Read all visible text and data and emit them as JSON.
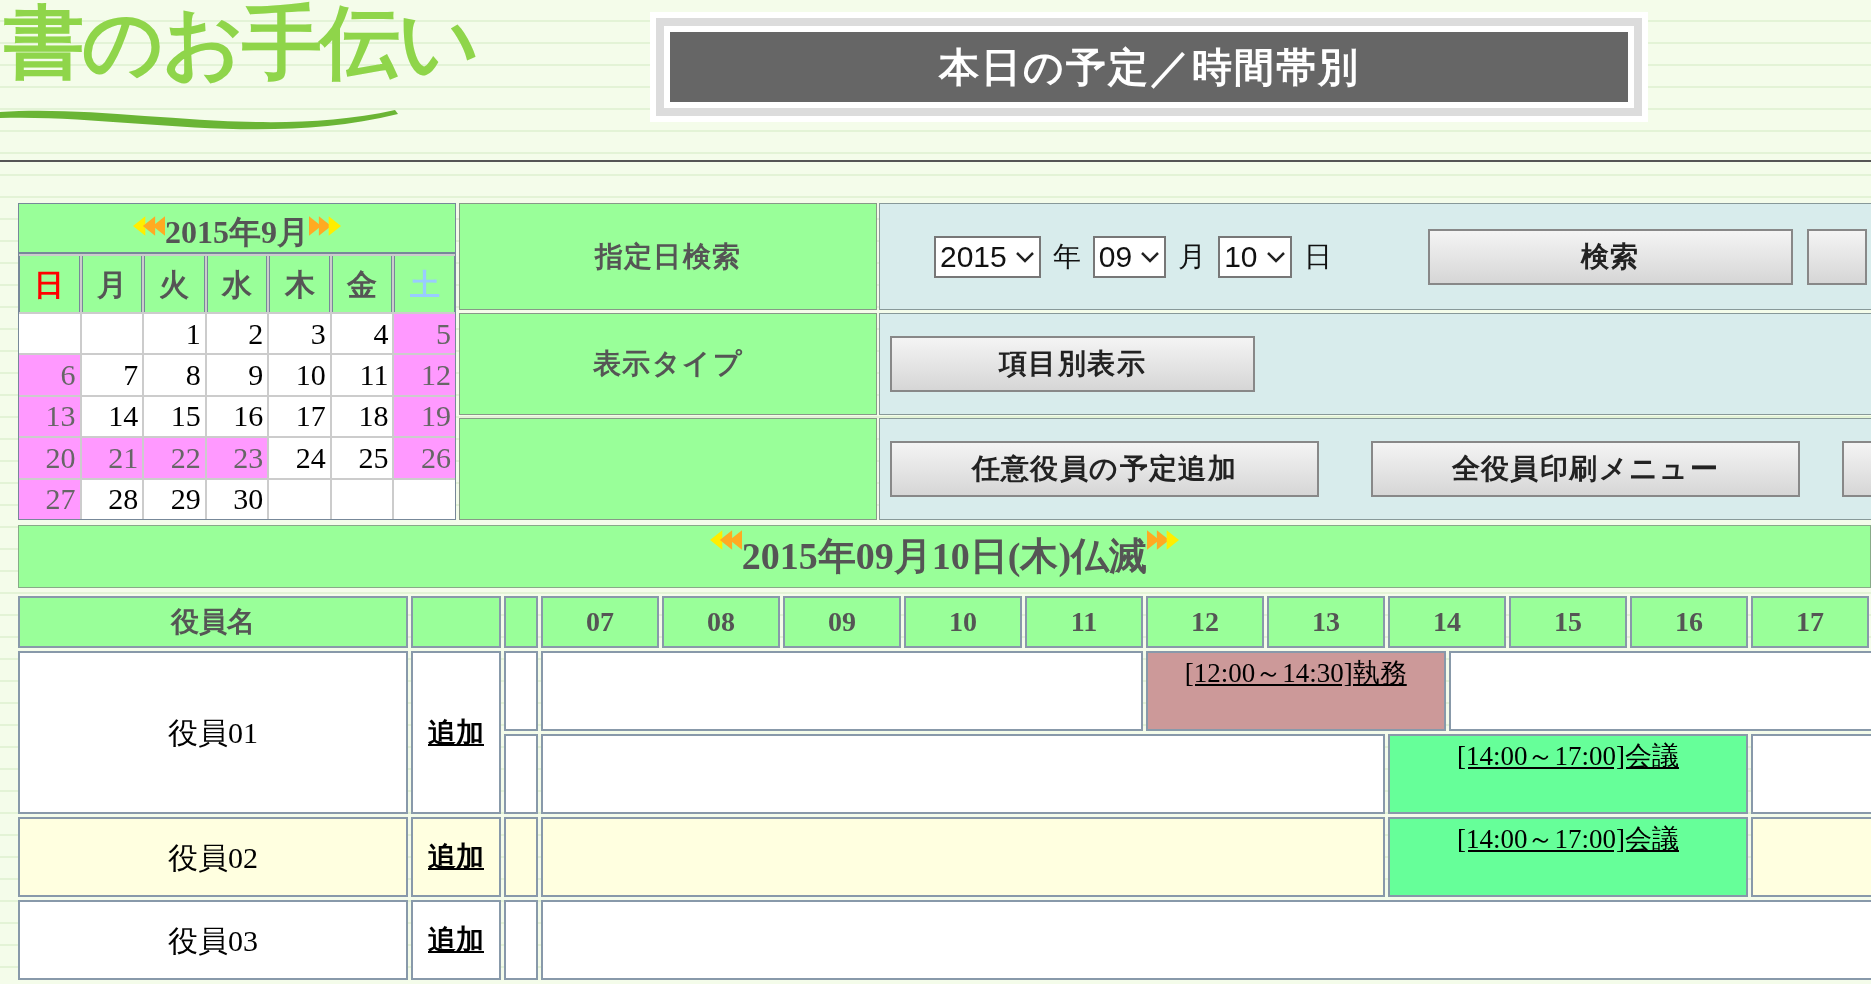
{
  "logo": {
    "text": "書のお手伝い"
  },
  "title": "本日の予定／時間帯別",
  "calendar": {
    "month": "2015年9月",
    "weekdays": [
      {
        "label": "日",
        "kind": "sunday"
      },
      {
        "label": "月",
        "kind": "weekday"
      },
      {
        "label": "火",
        "kind": "weekday"
      },
      {
        "label": "水",
        "kind": "weekday"
      },
      {
        "label": "木",
        "kind": "weekday"
      },
      {
        "label": "金",
        "kind": "weekday"
      },
      {
        "label": "土",
        "kind": "saturday"
      }
    ],
    "weeks": [
      [
        {
          "holiday": false
        },
        {
          "holiday": false
        },
        {
          "day": "1",
          "holiday": false
        },
        {
          "day": "2",
          "holiday": false
        },
        {
          "day": "3",
          "holiday": false
        },
        {
          "day": "4",
          "holiday": false
        },
        {
          "day": "5",
          "holiday": true
        }
      ],
      [
        {
          "day": "6",
          "holiday": true
        },
        {
          "day": "7",
          "holiday": false
        },
        {
          "day": "8",
          "holiday": false
        },
        {
          "day": "9",
          "holiday": false
        },
        {
          "day": "10",
          "holiday": false
        },
        {
          "day": "11",
          "holiday": false
        },
        {
          "day": "12",
          "holiday": true
        }
      ],
      [
        {
          "day": "13",
          "holiday": true
        },
        {
          "day": "14",
          "holiday": false
        },
        {
          "day": "15",
          "holiday": false
        },
        {
          "day": "16",
          "holiday": false
        },
        {
          "day": "17",
          "holiday": false
        },
        {
          "day": "18",
          "holiday": false
        },
        {
          "day": "19",
          "holiday": true
        }
      ],
      [
        {
          "day": "20",
          "holiday": true
        },
        {
          "day": "21",
          "holiday": true
        },
        {
          "day": "22",
          "holiday": true
        },
        {
          "day": "23",
          "holiday": true
        },
        {
          "day": "24",
          "holiday": false
        },
        {
          "day": "25",
          "holiday": false
        },
        {
          "day": "26",
          "holiday": true
        }
      ],
      [
        {
          "day": "27",
          "holiday": true
        },
        {
          "day": "28",
          "holiday": false
        },
        {
          "day": "29",
          "holiday": false
        },
        {
          "day": "30",
          "holiday": false
        },
        {
          "holiday": false
        },
        {
          "holiday": false
        },
        {
          "holiday": false
        }
      ]
    ]
  },
  "search": {
    "label": "指定日検索",
    "year": "2015",
    "year_unit": "年",
    "month": "09",
    "month_unit": "月",
    "day": "10",
    "day_unit": "日",
    "button": "検索"
  },
  "display_type": {
    "label": "表示タイプ",
    "button": "項目別表示"
  },
  "actions": {
    "buttons": [
      "任意役員の予定追加",
      "全役員印刷メニュー"
    ]
  },
  "date_bar": "2015年09月10日(木)仏滅",
  "schedule": {
    "name_header": "役員名",
    "hours": [
      "07",
      "08",
      "09",
      "10",
      "11",
      "12",
      "13",
      "14",
      "15",
      "16",
      "17"
    ],
    "members": [
      {
        "name": "役員01",
        "add": "追加",
        "shaded": false,
        "lanes": [
          {
            "events": [
              {
                "open": "[",
                "start": "12:00",
                "to": "～",
                "end": "14:30",
                "close": "]",
                "title": "執務",
                "color": "#cc9999"
              }
            ]
          },
          {
            "events": [
              {
                "open": "[",
                "start": "14:00",
                "to": "～",
                "end": "17:00",
                "close": "]",
                "title": "会議",
                "color": "#66ff99"
              }
            ]
          }
        ]
      },
      {
        "name": "役員02",
        "add": "追加",
        "shaded": true,
        "lanes": [
          {
            "events": [
              {
                "open": "[",
                "start": "14:00",
                "to": "～",
                "end": "17:00",
                "close": "]",
                "title": "会議",
                "color": "#66ff99"
              }
            ]
          }
        ]
      },
      {
        "name": "役員03",
        "add": "追加",
        "shaded": false
      }
    ]
  }
}
